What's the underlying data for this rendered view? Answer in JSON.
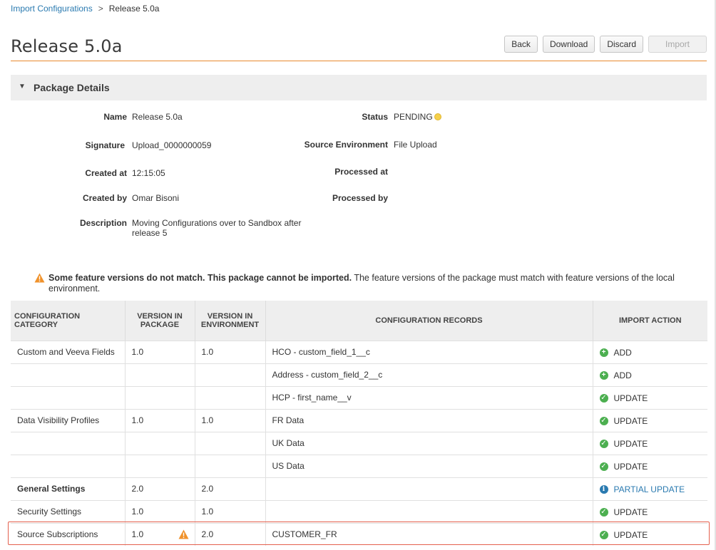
{
  "breadcrumb": {
    "parent": "Import Configurations",
    "separator": ">",
    "current": "Release 5.0a"
  },
  "header": {
    "title": "Release 5.0a"
  },
  "buttons": {
    "back": "Back",
    "download": "Download",
    "discard": "Discard",
    "import": "Import"
  },
  "package_details": {
    "section_label": "Package Details",
    "labels": {
      "name": "Name",
      "signature": "Signature",
      "created_at": "Created at",
      "created_by": "Created by",
      "description": "Description",
      "status": "Status",
      "source_environment": "Source Environment",
      "processed_at": "Processed at",
      "processed_by": "Processed by"
    },
    "values": {
      "name": "Release 5.0a",
      "signature": "Upload_0000000059",
      "created_at": "12:15:05",
      "created_by": "Omar Bisoni",
      "description_line1": "Moving Configurations over to Sandbox after",
      "description_line2": "release 5",
      "status": "PENDING",
      "source_environment": "File Upload"
    }
  },
  "warning": {
    "bold": "Some feature versions do not match. This package cannot be imported.",
    "rest": " The feature versions of the package must match with feature versions of the local environment."
  },
  "table": {
    "headers": {
      "category_1": "CONFIGURATION",
      "category_2": "CATEGORY",
      "pkg_1": "VERSION IN",
      "pkg_2": "PACKAGE",
      "env_1": "VERSION IN",
      "env_2": "ENVIRONMENT",
      "records": "CONFIGURATION RECORDS",
      "action": "IMPORT ACTION"
    },
    "rows": [
      {
        "category": "Custom and Veeva Fields",
        "pkg": "1.0",
        "env": "1.0",
        "record": "HCO - custom_field_1__c",
        "action": "ADD"
      },
      {
        "category": "",
        "pkg": "",
        "env": "",
        "record": "Address - custom_field_2__c",
        "action": "ADD"
      },
      {
        "category": "",
        "pkg": "",
        "env": "",
        "record": "HCP - first_name__v",
        "action": "UPDATE"
      },
      {
        "category": "Data Visibility Profiles",
        "pkg": "1.0",
        "env": "1.0",
        "record": "FR Data",
        "action": "UPDATE"
      },
      {
        "category": "",
        "pkg": "",
        "env": "",
        "record": "UK Data",
        "action": "UPDATE"
      },
      {
        "category": "",
        "pkg": "",
        "env": "",
        "record": "US Data",
        "action": "UPDATE"
      },
      {
        "category": "General Settings",
        "pkg": "2.0",
        "env": "2.0",
        "record": "",
        "action": "PARTIAL UPDATE"
      },
      {
        "category": "Security Settings",
        "pkg": "1.0",
        "env": "1.0",
        "record": "",
        "action": "UPDATE"
      },
      {
        "category": "Source Subscriptions",
        "pkg": "1.0",
        "env": "2.0",
        "record": "CUSTOMER_FR",
        "action": "UPDATE"
      }
    ]
  },
  "colors": {
    "accent": "#e8892e",
    "link": "#2a7ab0",
    "success": "#4caf50",
    "warning": "#f0922b",
    "highlight": "#e4604d"
  }
}
